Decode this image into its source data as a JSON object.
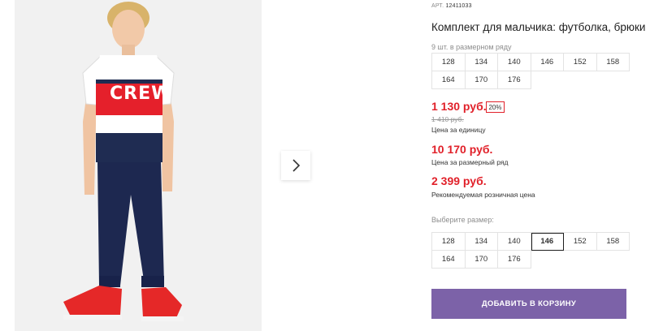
{
  "product": {
    "article_label": "АРТ.",
    "article_value": "12411033",
    "title": "Комплект для мальчика: футболка, брюки",
    "photo_print_text": "CREW",
    "pack_caption": "9 шт. в размерном ряду",
    "pack_sizes": [
      "128",
      "134",
      "140",
      "146",
      "152",
      "158",
      "164",
      "170",
      "176"
    ]
  },
  "pricing": {
    "unit_price": "1 130 руб.",
    "discount_badge": "20%",
    "old_price": "1 410 руб.",
    "unit_price_note": "Цена за единицу",
    "row_price": "10 170 руб.",
    "row_price_note": "Цена за размерный ряд",
    "retail_price": "2 399 руб.",
    "retail_price_note": "Рекомендуемая розничная цена"
  },
  "size_select": {
    "caption": "Выберите размер:",
    "options": [
      "128",
      "134",
      "140",
      "146",
      "152",
      "158",
      "164",
      "170",
      "176"
    ],
    "selected": "146"
  },
  "actions": {
    "add_to_cart": "ДОБАВИТЬ В КОРЗИНУ"
  },
  "icons": {
    "next": "chevron-right-icon"
  },
  "colors": {
    "price_red": "#e1212a",
    "button_purple": "#7c62a8",
    "border_gray": "#e3e3e3"
  }
}
